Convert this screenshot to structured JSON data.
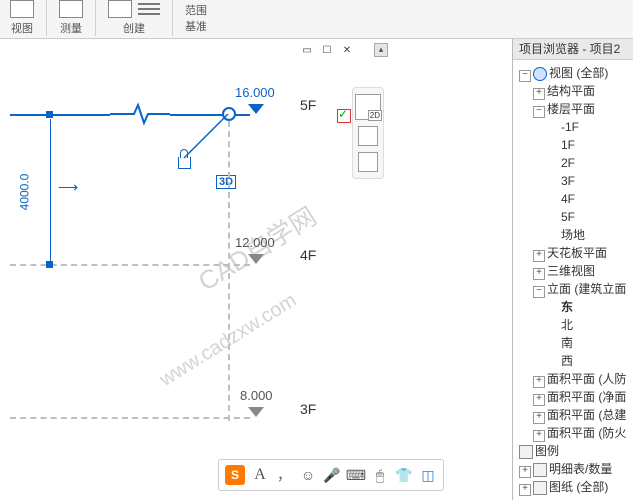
{
  "ribbon": {
    "groups": [
      {
        "label": "视图"
      },
      {
        "label": "测量"
      },
      {
        "label": "创建"
      },
      {
        "label_top": "范围",
        "label_bot": "基准"
      }
    ]
  },
  "browser": {
    "title": "项目浏览器 - 项目2",
    "tree": [
      {
        "d": 0,
        "tw": "−",
        "ico": "circle",
        "txt": "视图 (全部)"
      },
      {
        "d": 1,
        "tw": "+",
        "txt": "结构平面"
      },
      {
        "d": 1,
        "tw": "−",
        "txt": "楼层平面"
      },
      {
        "d": 2,
        "txt": "-1F"
      },
      {
        "d": 2,
        "txt": "1F"
      },
      {
        "d": 2,
        "txt": "2F"
      },
      {
        "d": 2,
        "txt": "3F"
      },
      {
        "d": 2,
        "txt": "4F"
      },
      {
        "d": 2,
        "txt": "5F"
      },
      {
        "d": 2,
        "txt": "场地"
      },
      {
        "d": 1,
        "tw": "+",
        "txt": "天花板平面"
      },
      {
        "d": 1,
        "tw": "+",
        "txt": "三维视图"
      },
      {
        "d": 1,
        "tw": "−",
        "txt": "立面 (建筑立面"
      },
      {
        "d": 2,
        "txt": "东",
        "bold": true
      },
      {
        "d": 2,
        "txt": "北"
      },
      {
        "d": 2,
        "txt": "南"
      },
      {
        "d": 2,
        "txt": "西"
      },
      {
        "d": 1,
        "tw": "+",
        "txt": "面积平面 (人防"
      },
      {
        "d": 1,
        "tw": "+",
        "txt": "面积平面 (净面"
      },
      {
        "d": 1,
        "tw": "+",
        "txt": "面积平面 (总建"
      },
      {
        "d": 1,
        "tw": "+",
        "txt": "面积平面 (防火"
      },
      {
        "d": 0,
        "tw": "",
        "ico": "folder",
        "txt": "图例"
      },
      {
        "d": 0,
        "tw": "+",
        "ico": "folder",
        "txt": "明细表/数量"
      },
      {
        "d": 0,
        "tw": "+",
        "ico": "folder",
        "txt": "图纸 (全部)"
      }
    ]
  },
  "levels": {
    "l5": {
      "val": "16.000",
      "name": "5F"
    },
    "l4": {
      "val": "12.000",
      "name": "4F"
    },
    "l3": {
      "val": "8.000",
      "name": "3F"
    },
    "dim_45": "4000.0",
    "tag_3d": "3D"
  },
  "nav": {
    "sub": "2D"
  },
  "ime": {
    "letter": "A",
    "items": [
      "，",
      "☺",
      "🎤",
      "⌨",
      "🖱",
      "👕",
      "◫"
    ]
  },
  "watermark": {
    "a": "CAD自学网",
    "b": "www.cadzxw.com"
  },
  "winbtns": {
    "restore": "▭",
    "max": "☐",
    "close": "✕"
  }
}
